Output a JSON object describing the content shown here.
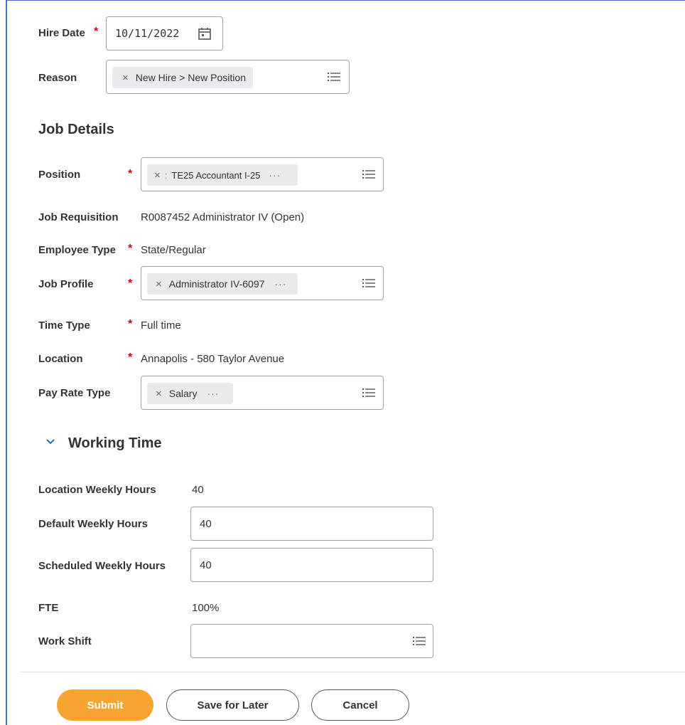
{
  "hire_date": {
    "label": "Hire Date",
    "value": "10/11/2022"
  },
  "reason": {
    "label": "Reason",
    "chip": "New Hire > New Position"
  },
  "job_details": {
    "heading": "Job Details",
    "position": {
      "label": "Position",
      "chip": "TE25 Accountant I-25",
      "chip_prefix": ":"
    },
    "job_requisition": {
      "label": "Job Requisition",
      "value": "R0087452 Administrator IV (Open)"
    },
    "employee_type": {
      "label": "Employee Type",
      "value": "State/Regular"
    },
    "job_profile": {
      "label": "Job Profile",
      "chip": "Administrator IV-6097"
    },
    "time_type": {
      "label": "Time Type",
      "value": "Full time"
    },
    "location": {
      "label": "Location",
      "value": "Annapolis - 580 Taylor Avenue"
    },
    "pay_rate_type": {
      "label": "Pay Rate Type",
      "chip": "Salary"
    }
  },
  "working_time": {
    "heading": "Working Time",
    "location_weekly_hours": {
      "label": "Location Weekly Hours",
      "value": "40"
    },
    "default_weekly_hours": {
      "label": "Default Weekly Hours",
      "value": "40"
    },
    "scheduled_weekly_hours": {
      "label": "Scheduled Weekly Hours",
      "value": "40"
    },
    "fte": {
      "label": "FTE",
      "value": "100%"
    },
    "work_shift": {
      "label": "Work Shift",
      "value": ""
    }
  },
  "buttons": {
    "submit": "Submit",
    "save_for_later": "Save for Later",
    "cancel": "Cancel"
  },
  "icons": {
    "required": "*",
    "remove": "×",
    "more": "···",
    "chevron": "⌄"
  },
  "colors": {
    "accent": "#f7a431",
    "required": "#d0021b",
    "chevron": "#1f73b7"
  }
}
